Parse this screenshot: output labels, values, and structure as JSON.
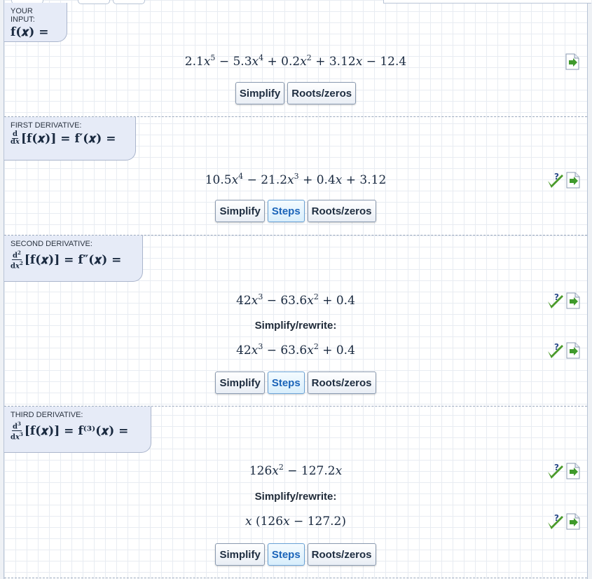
{
  "sections": [
    {
      "title": "YOUR INPUT:",
      "expr_f": "f(𝒙) =",
      "result": "2.1𝑥⁵ − 5.3𝑥⁴ + 0.2𝑥² + 3.12𝑥 − 12.4",
      "buttons": [
        "Simplify",
        "Roots/zeros"
      ]
    },
    {
      "title": "FIRST DERIVATIVE:",
      "expr_lhs": "[f(𝒙)] = f′(𝒙) =",
      "result": "10.5𝑥⁴ − 21.2𝑥³ + 0.4𝑥 + 3.12",
      "buttons": [
        "Simplify",
        "Steps",
        "Roots/zeros"
      ]
    },
    {
      "title": "SECOND DERIVATIVE:",
      "expr_lhs": "[f(𝒙)] = f″(𝒙) =",
      "result": "42𝑥³ − 63.6𝑥² + 0.4",
      "rewrite_label": "Simplify/rewrite:",
      "rewrite": "42𝑥³ − 63.6𝑥² + 0.4",
      "buttons": [
        "Simplify",
        "Steps",
        "Roots/zeros"
      ]
    },
    {
      "title": "THIRD DERIVATIVE:",
      "expr_lhs": "[f(𝒙)] = f⁽³⁾(𝒙) =",
      "result": "126𝑥² − 127.2𝑥",
      "rewrite_label": "Simplify/rewrite:",
      "rewrite": "𝑥 (126𝑥 − 127.2)",
      "buttons": [
        "Simplify",
        "Steps",
        "Roots/zeros"
      ]
    }
  ],
  "icons": {
    "check": "check-icon",
    "export": "export-icon",
    "check_color": "#4a9a2a",
    "question_color": "#2b4a8a"
  }
}
